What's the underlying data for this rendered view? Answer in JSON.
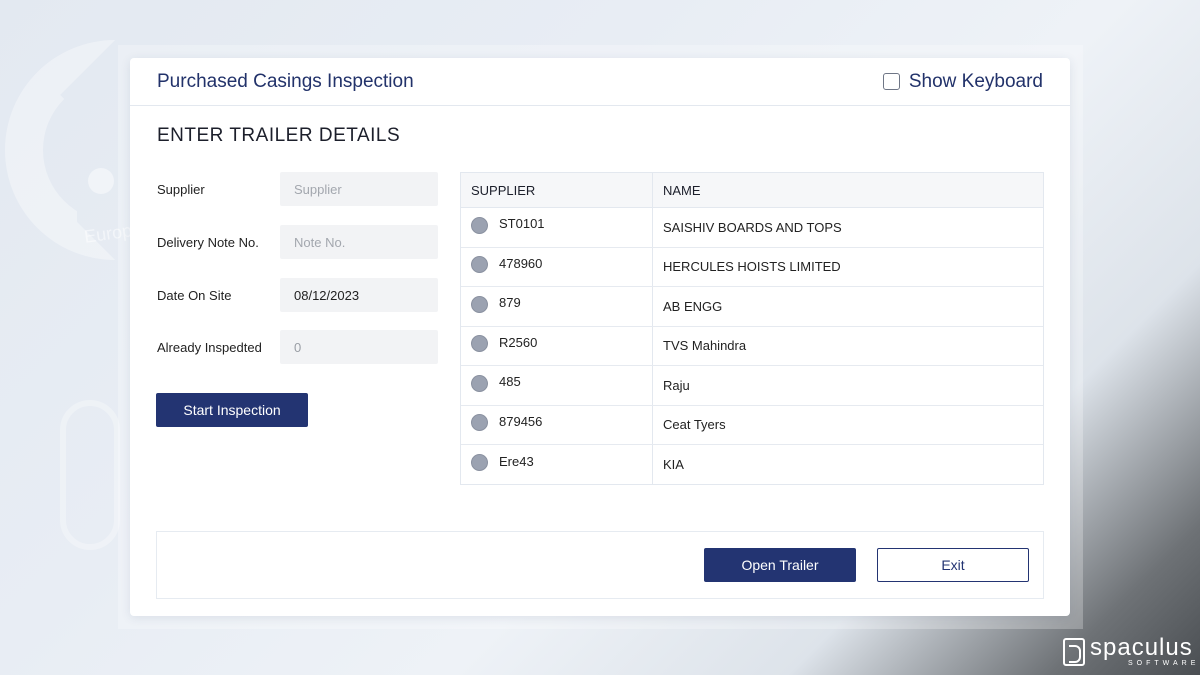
{
  "app": {
    "title": "Purchased Casings Inspection",
    "show_keyboard_label": "Show Keyboard",
    "show_keyboard_checked": false
  },
  "section_title": "ENTER TRAILER DETAILS",
  "form": {
    "supplier": {
      "label": "Supplier",
      "value": "",
      "placeholder": "Supplier"
    },
    "delivery_note": {
      "label": "Delivery Note No.",
      "value": "",
      "placeholder": "Note No."
    },
    "date_on_site": {
      "label": "Date On Site",
      "value": "08/12/2023"
    },
    "already_inspected": {
      "label": "Already Inspedted",
      "value": "0"
    },
    "start_button": "Start Inspection"
  },
  "table": {
    "headers": [
      "SUPPLIER",
      "NAME"
    ],
    "rows": [
      {
        "code": "ST0101",
        "name": "SAISHIV BOARDS AND TOPS"
      },
      {
        "code": "478960",
        "name": "HERCULES HOISTS LIMITED"
      },
      {
        "code": "879",
        "name": "AB ENGG"
      },
      {
        "code": "R2560",
        "name": "TVS Mahindra"
      },
      {
        "code": "485",
        "name": "Raju"
      },
      {
        "code": "879456",
        "name": "Ceat Tyers"
      },
      {
        "code": "Ere43",
        "name": "KIA"
      }
    ]
  },
  "footer": {
    "open_trailer": "Open Trailer",
    "exit": "Exit"
  },
  "background": {
    "watermark_text": "Europe's"
  },
  "brand": {
    "name": "spaculus",
    "tagline": "SOFTWARE"
  },
  "colors": {
    "primary": "#233472",
    "radio": "#9ba2b1"
  }
}
